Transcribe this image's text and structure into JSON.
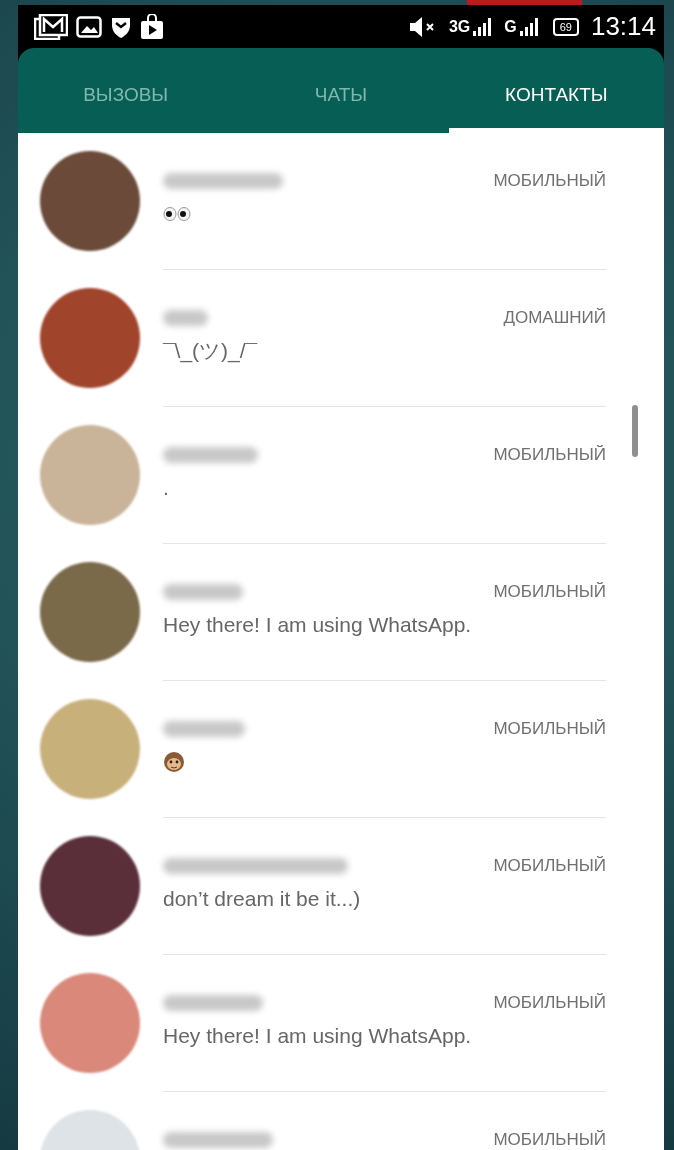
{
  "status_bar": {
    "network_1": "3G",
    "network_2": "G",
    "battery": "69",
    "time": "13:14"
  },
  "tabs": [
    {
      "label": "ВЫЗОВЫ",
      "selected": false
    },
    {
      "label": "ЧАТЫ",
      "selected": false
    },
    {
      "label": "КОНТАКТЫ",
      "selected": true
    }
  ],
  "contacts": [
    {
      "phone_type": "МОБИЛЬНЫЙ",
      "kind": "eyes"
    },
    {
      "phone_type": "ДОМАШНИЙ",
      "status": "¯\\_(ツ)_/¯"
    },
    {
      "phone_type": "МОБИЛЬНЫЙ",
      "status": "."
    },
    {
      "phone_type": "МОБИЛЬНЫЙ",
      "status": "Hey there! I am using WhatsApp."
    },
    {
      "phone_type": "МОБИЛЬНЫЙ",
      "kind": "monkey"
    },
    {
      "phone_type": "МОБИЛЬНЫЙ",
      "status": "don’t dream it be it...)"
    },
    {
      "phone_type": "МОБИЛЬНЫЙ",
      "status": "Hey there! I am using WhatsApp."
    },
    {
      "phone_type": "МОБИЛЬНЫЙ"
    }
  ]
}
